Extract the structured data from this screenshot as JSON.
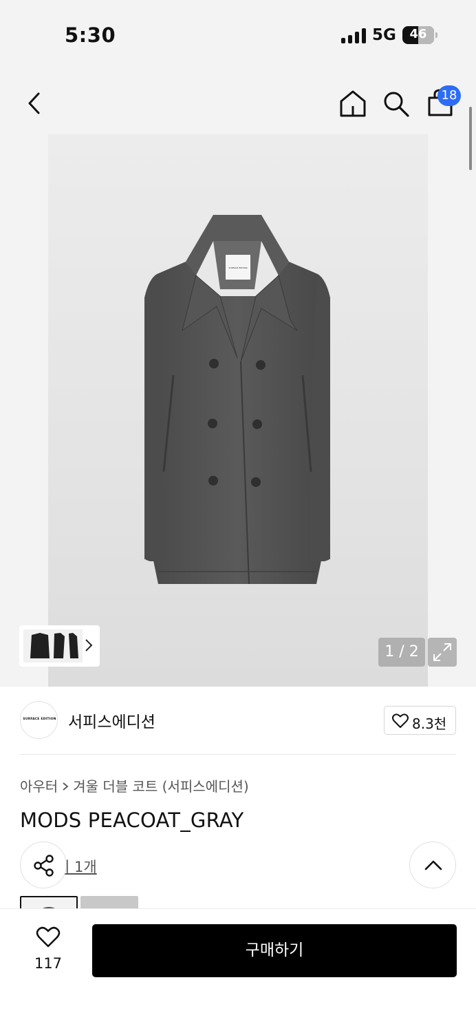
{
  "status_bar": {
    "time": "5:30",
    "network": "5G",
    "battery": "46"
  },
  "nav": {
    "back_icon": "chevron-left-icon",
    "home_icon": "home-icon",
    "search_icon": "search-icon",
    "cart_icon": "shopping-bag-icon",
    "cart_badge": "18",
    "badge_color": "#2d6cf5"
  },
  "gallery": {
    "page_indicator": "1 / 2",
    "expand_icon": "expand-icon",
    "thumb_chevron_icon": "chevron-right-icon",
    "coat_label_text": "SURFACE EDITION"
  },
  "brand": {
    "logo_text": "SURFACE EDITION",
    "name": "서피스에디션",
    "like_count": "8.3천"
  },
  "product": {
    "breadcrumb": [
      "아우터",
      "겨울 더블 코트 (서피스에디션)"
    ],
    "title": "MODS PEACOAT_GRAY",
    "review_link": "기 1개"
  },
  "actions": {
    "share_icon": "share-icon",
    "scroll_top_icon": "chevron-up-icon",
    "wishlist_icon": "heart-icon",
    "wishlist_count": "117",
    "buy_label": "구매하기",
    "buy_color": "#000000"
  }
}
